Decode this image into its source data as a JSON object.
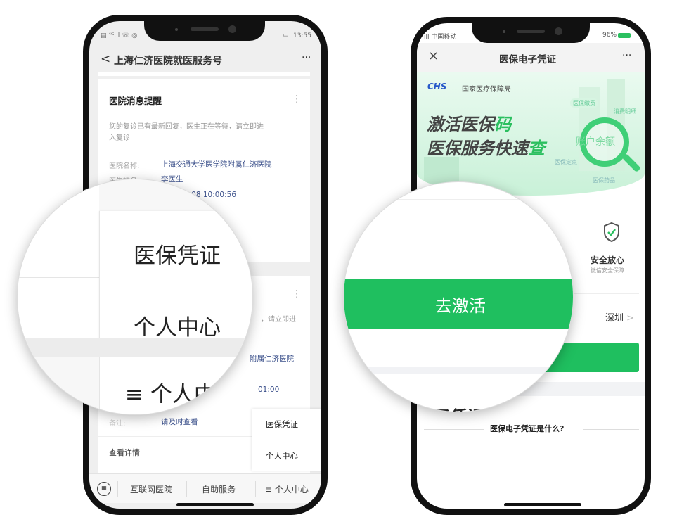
{
  "left_phone": {
    "status": {
      "left": "▤ ⁴ᴳ.ıl ☏ ◎",
      "time": "13:55",
      "battery": "▭"
    },
    "nav": {
      "back": "<",
      "title": "上海仁济医院就医服务号",
      "more": "···"
    },
    "card1": {
      "title": "医院消息提醒",
      "menu": "⋮",
      "message_line1": "您的复诊已有最新回复，医生正在等待，请立即进",
      "message_line2": "入复诊",
      "hospital_label": "医院名称:",
      "hospital_value": "上海交通大学医学院附属仁济医院",
      "doctor_label": "医生姓名:",
      "doctor_value": "李医生",
      "time_value_partial": "06-08 10:00:56"
    },
    "card2": {
      "menu": "⋮",
      "message_partial": "，请立即进",
      "hospital_partial": "附属仁济医院",
      "time_partial": "01:00",
      "note_label": "备注:",
      "note_value": "请及时查看",
      "details": "查看详情"
    },
    "popup_menu": [
      "医保凭证",
      "个人中心"
    ],
    "bottom_bar": {
      "keyboard_icon": "keyboard-icon",
      "items": [
        "互联网医院",
        "自助服务",
        "≡ 个人中心"
      ]
    },
    "magnifier": {
      "item1": "医保凭证",
      "item2": "个人中心",
      "bottom": "≡ 个人中"
    }
  },
  "right_phone": {
    "status": {
      "carrier": "ıll 中国移动",
      "battery": "96%"
    },
    "nav": {
      "close": "×",
      "title": "医保电子凭证",
      "more": "···"
    },
    "banner": {
      "logo": "CHS",
      "org": "国家医疗保障局",
      "headline1_a": "激活医保",
      "headline1_b": "码",
      "headline2_a": "医保服务快速",
      "headline2_b": "查",
      "tags": [
        "医保缴费",
        "消费明细",
        "账户余额",
        "医保定点",
        "医保药品"
      ]
    },
    "security": {
      "title": "安全放心",
      "subtitle": "微信安全保障"
    },
    "region": {
      "value": "深圳",
      "chevron": ">"
    },
    "faq_title": "医保电子凭证是什么?",
    "magnifier": {
      "button": "去激活",
      "bottom_partial": "电子凭证是什"
    },
    "colors": {
      "accent": "#1fbf5f",
      "blue_link": "#3a4f8a"
    }
  }
}
